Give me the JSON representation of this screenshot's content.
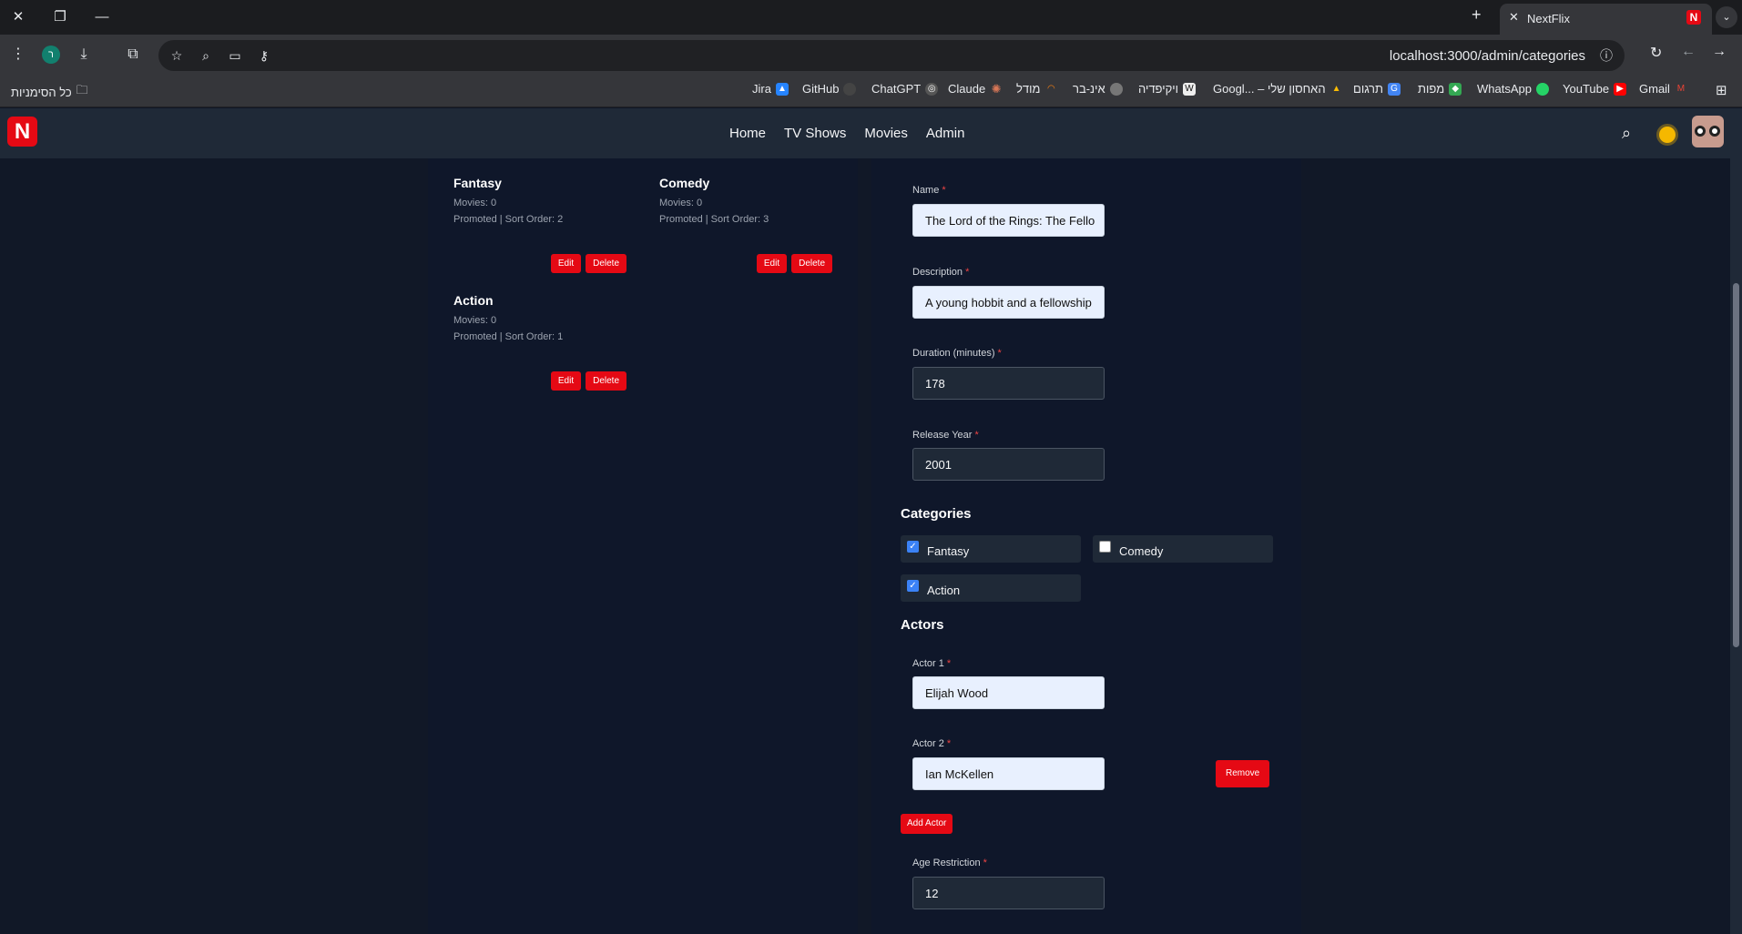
{
  "browser": {
    "tab_title": "NextFlix",
    "url": "localhost:3000/admin/categories",
    "profile_initial": "ר",
    "bookmarks": [
      {
        "label": "Jira",
        "icon": "jira-icon",
        "color": "#2684ff"
      },
      {
        "label": "GitHub",
        "icon": "github-icon",
        "color": "#444"
      },
      {
        "label": "ChatGPT",
        "icon": "chatgpt-icon",
        "color": "#555"
      },
      {
        "label": "Claude",
        "icon": "claude-icon",
        "color": "#d97757"
      },
      {
        "label": "מודל",
        "icon": "moodle-icon",
        "color": "#f98012"
      },
      {
        "label": "אינ-בר",
        "icon": "globe-icon",
        "color": "#777"
      },
      {
        "label": "ויקיפדיה",
        "icon": "wikipedia-icon",
        "color": "#eee"
      },
      {
        "label": "Googl... – האחסון שלי",
        "icon": "drive-icon",
        "color": "#34a853"
      },
      {
        "label": "תרגום",
        "icon": "translate-icon",
        "color": "#4285f4"
      },
      {
        "label": "מפות",
        "icon": "maps-icon",
        "color": "#34a853"
      },
      {
        "label": "WhatsApp",
        "icon": "whatsapp-icon",
        "color": "#25d366"
      },
      {
        "label": "YouTube",
        "icon": "youtube-icon",
        "color": "#ff0000"
      },
      {
        "label": "Gmail",
        "icon": "gmail-icon",
        "color": "#ea4335"
      }
    ],
    "all_bookmarks": "כל הסימניות"
  },
  "site": {
    "logo": "N",
    "nav": [
      "Home",
      "TV Shows",
      "Movies",
      "Admin"
    ]
  },
  "categories": [
    {
      "name": "Fantasy",
      "movies": "Movies: 0",
      "meta": "Promoted | Sort Order: 2"
    },
    {
      "name": "Comedy",
      "movies": "Movies: 0",
      "meta": "Promoted | Sort Order: 3"
    },
    {
      "name": "Action",
      "movies": "Movies: 0",
      "meta": "Promoted | Sort Order: 1"
    }
  ],
  "buttons": {
    "edit": "Edit",
    "delete": "Delete",
    "remove": "Remove",
    "add_actor": "Add Actor"
  },
  "form": {
    "name_label": "Name",
    "name_value": "The Lord of the Rings: The Fello",
    "description_label": "Description",
    "description_value": "A young hobbit and a fellowship",
    "duration_label": "Duration (minutes)",
    "duration_value": "178",
    "year_label": "Release Year",
    "year_value": "2001",
    "categories_title": "Categories",
    "category_checks": [
      {
        "label": "Fantasy",
        "checked": true
      },
      {
        "label": "Comedy",
        "checked": false
      },
      {
        "label": "Action",
        "checked": true
      }
    ],
    "actors_title": "Actors",
    "actor1_label": "Actor 1",
    "actor1_value": "Elijah Wood",
    "actor2_label": "Actor 2",
    "actor2_value": "Ian McKellen",
    "age_label": "Age Restriction",
    "age_value": "12",
    "required_mark": "*"
  }
}
